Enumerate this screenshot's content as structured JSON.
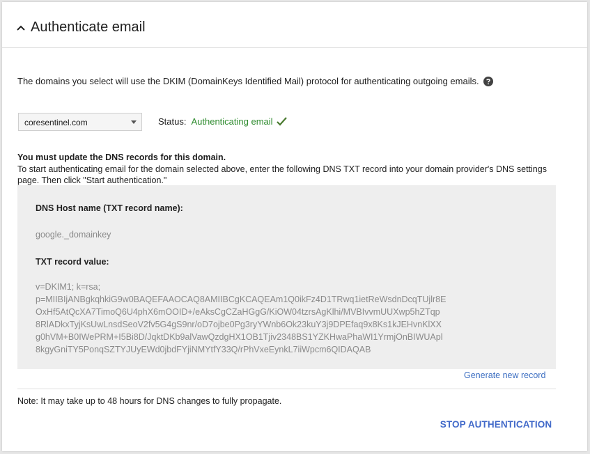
{
  "header": {
    "title": "Authenticate email"
  },
  "description": "The domains you select will use the DKIM (DomainKeys Identified Mail) protocol for authenticating outgoing emails.",
  "domain_select": {
    "value": "coresentinel.com"
  },
  "status": {
    "label": "Status:",
    "value": "Authenticating email",
    "color": "#2e8b2e"
  },
  "instructions": {
    "title": "You must update the DNS records for this domain.",
    "text": "To start authenticating email for the domain selected above, enter the following DNS TXT record into your domain provider's DNS settings page. Then click \"Start authentication.\""
  },
  "dns": {
    "host_label": "DNS Host name (TXT record name):",
    "host_value": "google._domainkey",
    "txt_label": "TXT record value:",
    "txt_lines": [
      "v=DKIM1; k=rsa;",
      "p=MIIBIjANBgkqhkiG9w0BAQEFAAOCAQ8AMIIBCgKCAQEAm1Q0ikFz4D1TRwq1ietReWsdnDcqTUjlr8E",
      "OxHf5AtQcXA7TimoQ6U4phX6mOOID+/eAksCgCZaHGgG/KiOW04tzrsAgKlhi/MVBIvvmUUXwp5hZTqp",
      "8RlADkxTyjKsUwLnsdSeoV2fv5G4gS9nr/oD7ojbe0Pg3ryYWnb6Ok23kuY3j9DPEfaq9x8Ks1kJEHvnKlXX",
      "g0hVM+B0IWePRM+I5Bi8D/JqktDKb9alVawQzdgHX1OB1Tjiv2348BS1YZKHwaPhaWI1YrmjOnBIWUApl",
      "8kgyGniTY5PonqSZTYJUyEWd0jbdFYjiNMYtfY33Q/rPhVxeEynkL7iiWpcm6QIDAQAB"
    ]
  },
  "generate_link": "Generate new record",
  "note": "Note: It may take up to 48 hours for DNS changes to fully propagate.",
  "stop_button": "STOP AUTHENTICATION",
  "colors": {
    "link": "#3d6fc2",
    "button": "#4169c9"
  }
}
